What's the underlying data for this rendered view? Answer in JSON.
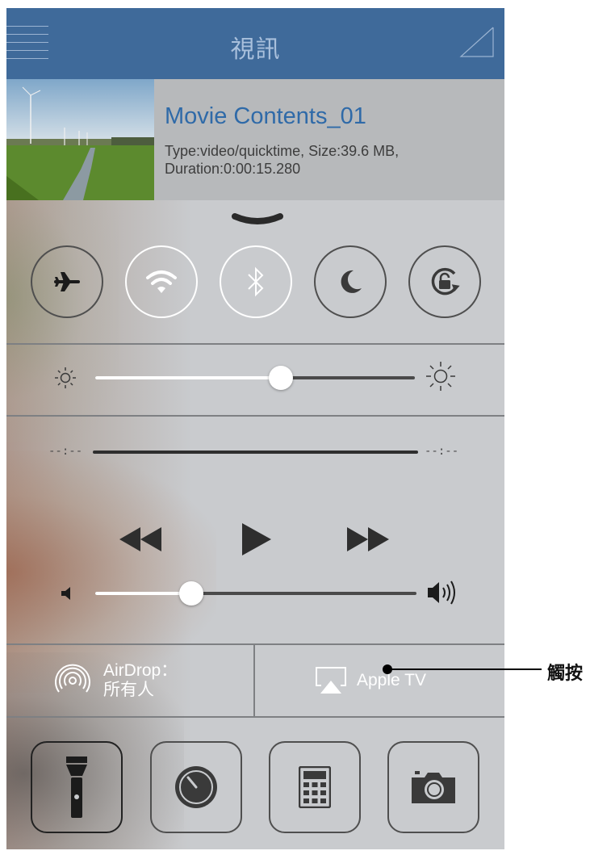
{
  "navbar": {
    "title": "視訊",
    "bg_color": "#3f6a9a"
  },
  "video_item": {
    "title": "Movie Contents_01",
    "meta": "Type:video/quicktime, Size:39.6 MB, Duration:0:00:15.280",
    "title_color": "#2f6aa8"
  },
  "control_center": {
    "toggles": [
      {
        "name": "airplane-mode",
        "icon": "airplane-icon",
        "active": false
      },
      {
        "name": "wifi",
        "icon": "wifi-icon",
        "active": true
      },
      {
        "name": "bluetooth",
        "icon": "bluetooth-icon",
        "active": true
      },
      {
        "name": "do-not-disturb",
        "icon": "moon-icon",
        "active": false
      },
      {
        "name": "rotation-lock",
        "icon": "rotation-lock-icon",
        "active": false
      }
    ],
    "brightness": {
      "level": 0.58
    },
    "media": {
      "elapsed": "--:--",
      "remaining": "--:--",
      "progress": 0
    },
    "volume": {
      "level": 0.3
    },
    "airdrop": {
      "label_line1": "AirDrop：",
      "label_line2": "所有人"
    },
    "airplay": {
      "label": "Apple TV"
    },
    "apps": [
      {
        "name": "flashlight",
        "icon": "flashlight-icon",
        "active": true
      },
      {
        "name": "timer",
        "icon": "timer-icon",
        "active": false
      },
      {
        "name": "calculator",
        "icon": "calculator-icon",
        "active": false
      },
      {
        "name": "camera",
        "icon": "camera-icon",
        "active": false
      }
    ]
  },
  "annotation": {
    "label": "觸按"
  }
}
